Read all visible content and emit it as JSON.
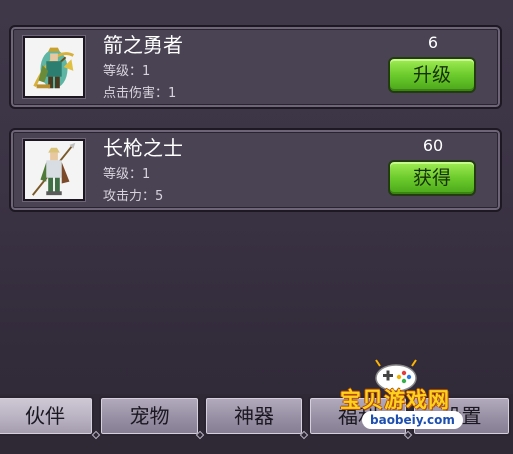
{
  "heroes": [
    {
      "name": "箭之勇者",
      "level_text": "等级：1",
      "stat_text": "点击伤害：1",
      "cost": "6",
      "action_label": "升级",
      "portrait": "archer-hero-sprite-icon"
    },
    {
      "name": "长枪之士",
      "level_text": "等级：1",
      "stat_text": "攻击力：5",
      "cost": "60",
      "action_label": "获得",
      "portrait": "spear-warrior-sprite-icon"
    }
  ],
  "tabs": [
    {
      "label": "伙伴",
      "active": true
    },
    {
      "label": "宠物",
      "active": false
    },
    {
      "label": "神器",
      "active": false
    },
    {
      "label": "福利",
      "active": false
    },
    {
      "label": "设置",
      "active": false
    }
  ],
  "watermark": {
    "text": "宝贝游戏网",
    "url": "baobeiy.com",
    "mascot": "gamepad-mascot-icon"
  },
  "colors": {
    "background": "#3c3546",
    "card": "#4a4354",
    "button_green": "#6ccb2c",
    "tab": "#978fa3",
    "watermark_yellow": "#ffd21f"
  }
}
